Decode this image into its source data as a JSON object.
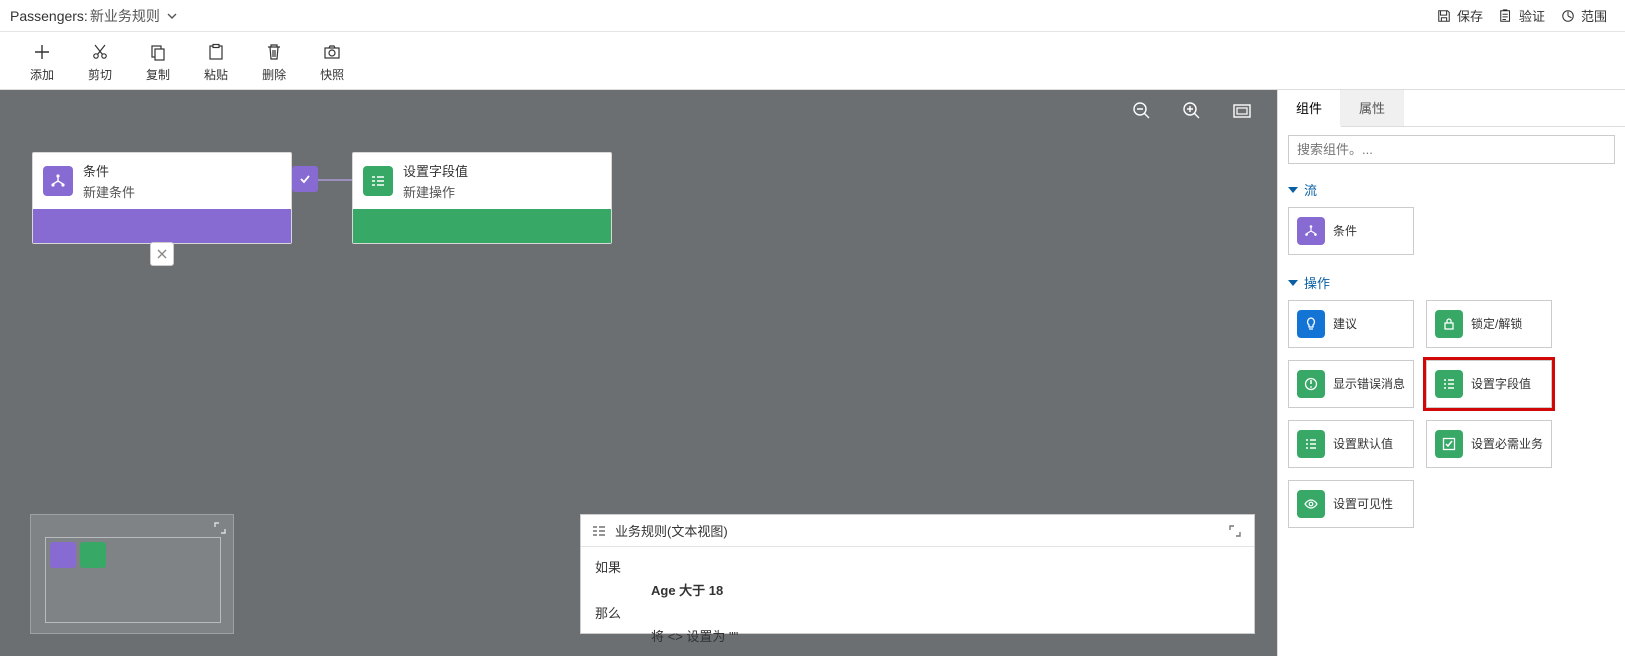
{
  "title": {
    "entity": "Passengers:",
    "rule": "新业务规则"
  },
  "headerActions": {
    "save": "保存",
    "validate": "验证",
    "scope": "范围"
  },
  "toolbar": {
    "add": "添加",
    "cut": "剪切",
    "copy": "复制",
    "paste": "粘贴",
    "delete": "删除",
    "snapshot": "快照"
  },
  "nodes": {
    "condition": {
      "title": "条件",
      "subtitle": "新建条件"
    },
    "action": {
      "title": "设置字段值",
      "subtitle": "新建操作"
    }
  },
  "textview": {
    "title": "业务规则(文本视图)",
    "if": "如果",
    "cond": "Age 大于 18",
    "then": "那么",
    "act": "将 <> 设置为 \"\""
  },
  "panel": {
    "tabs": {
      "components": "组件",
      "properties": "属性"
    },
    "searchPlaceholder": "搜索组件。...",
    "flow": {
      "header": "流",
      "condition": "条件"
    },
    "actions": {
      "header": "操作",
      "items": {
        "suggest": "建议",
        "lock": "锁定/解锁",
        "showError": "显示错误消息",
        "setField": "设置字段值",
        "setDefault": "设置默认值",
        "setRequired": "设置必需业务",
        "setVisible": "设置可见性"
      }
    }
  }
}
